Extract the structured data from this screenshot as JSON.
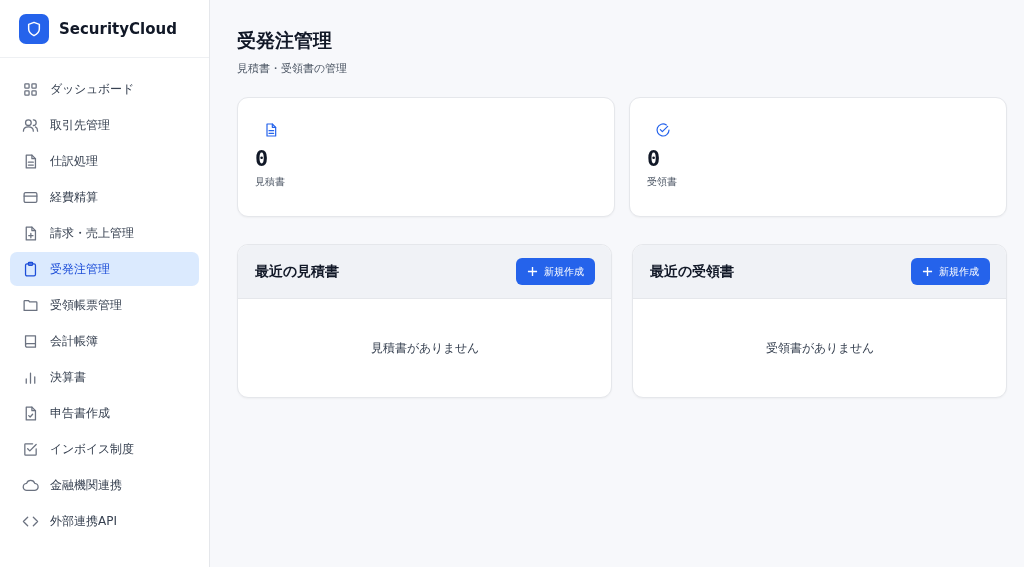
{
  "brand": {
    "name": "SecurityCloud"
  },
  "sidebar": {
    "items": [
      {
        "label": "ダッシュボード",
        "selected": false
      },
      {
        "label": "取引先管理",
        "selected": false
      },
      {
        "label": "仕訳処理",
        "selected": false
      },
      {
        "label": "経費精算",
        "selected": false
      },
      {
        "label": "請求・売上管理",
        "selected": false
      },
      {
        "label": "受発注管理",
        "selected": true
      },
      {
        "label": "受領帳票管理",
        "selected": false
      },
      {
        "label": "会計帳簿",
        "selected": false
      },
      {
        "label": "決算書",
        "selected": false
      },
      {
        "label": "申告書作成",
        "selected": false
      },
      {
        "label": "インボイス制度",
        "selected": false
      },
      {
        "label": "金融機関連携",
        "selected": false
      },
      {
        "label": "外部連携API",
        "selected": false
      }
    ]
  },
  "page": {
    "title": "受発注管理",
    "subtitle": "見積書・受領書の管理"
  },
  "stats": [
    {
      "value": "0",
      "label": "見積書"
    },
    {
      "value": "0",
      "label": "受領書"
    }
  ],
  "panels": [
    {
      "title": "最近の見積書",
      "button": "新規作成",
      "empty": "見積書がありません"
    },
    {
      "title": "最近の受領書",
      "button": "新規作成",
      "empty": "受領書がありません"
    }
  ]
}
